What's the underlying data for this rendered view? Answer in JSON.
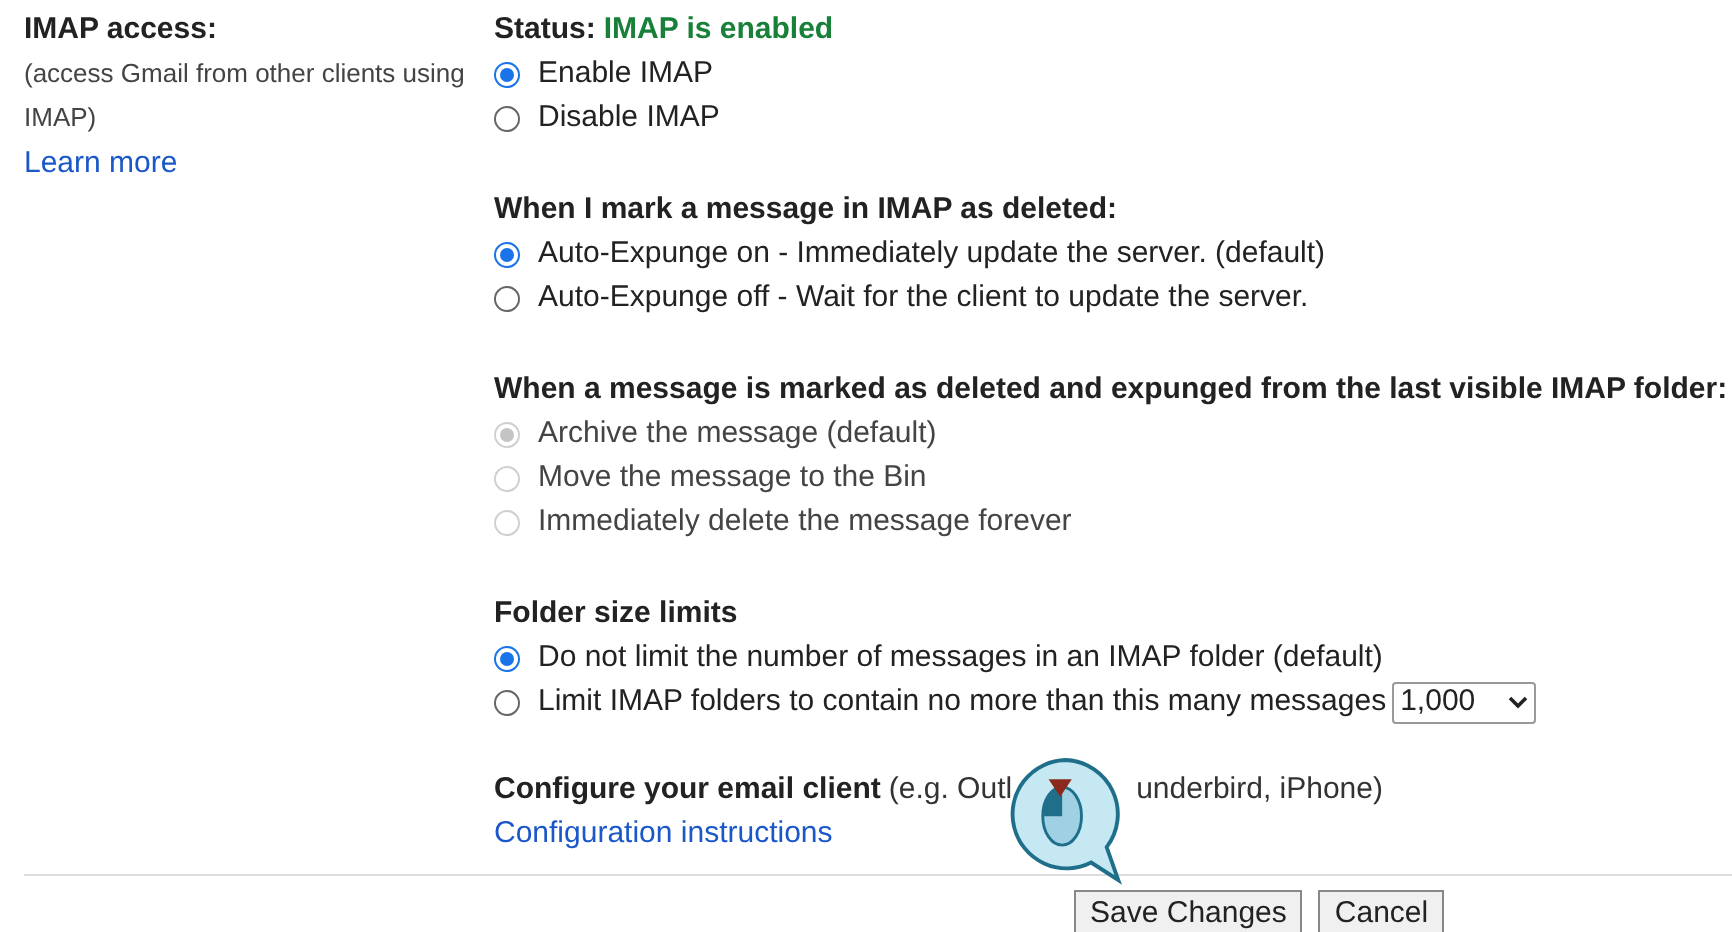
{
  "label": {
    "title": "IMAP access:",
    "description": "(access Gmail from other clients using IMAP)",
    "link": "Learn more"
  },
  "status": {
    "label": "Status:",
    "value": "IMAP is enabled"
  },
  "sections": [
    {
      "options": [
        {
          "label": "Enable IMAP",
          "selected": true,
          "disabled": false
        },
        {
          "label": "Disable IMAP",
          "selected": false,
          "disabled": false
        }
      ]
    },
    {
      "heading": "When I mark a message in IMAP as deleted:",
      "options": [
        {
          "label": "Auto-Expunge on - Immediately update the server. (default)",
          "selected": true,
          "disabled": false
        },
        {
          "label": "Auto-Expunge off - Wait for the client to update the server.",
          "selected": false,
          "disabled": false
        }
      ]
    },
    {
      "heading": "When a message is marked as deleted and expunged from the last visible IMAP folder:",
      "options": [
        {
          "label": "Archive the message (default)",
          "selected": true,
          "disabled": true
        },
        {
          "label": "Move the message to the Bin",
          "selected": false,
          "disabled": true
        },
        {
          "label": "Immediately delete the message forever",
          "selected": false,
          "disabled": true
        }
      ]
    },
    {
      "heading": "Folder size limits",
      "options": [
        {
          "label": "Do not limit the number of messages in an IMAP folder (default)",
          "selected": true,
          "disabled": false
        },
        {
          "label": "Limit IMAP folders to contain no more than this many messages",
          "selected": false,
          "disabled": false,
          "select_value": "1,000"
        }
      ]
    }
  ],
  "client": {
    "heading": "Configure your email client",
    "hint_before": "(e.g. Outl",
    "hint_after": "underbird, iPhone)",
    "link": "Configuration instructions"
  },
  "buttons": [
    "Save Changes",
    "Cancel"
  ]
}
